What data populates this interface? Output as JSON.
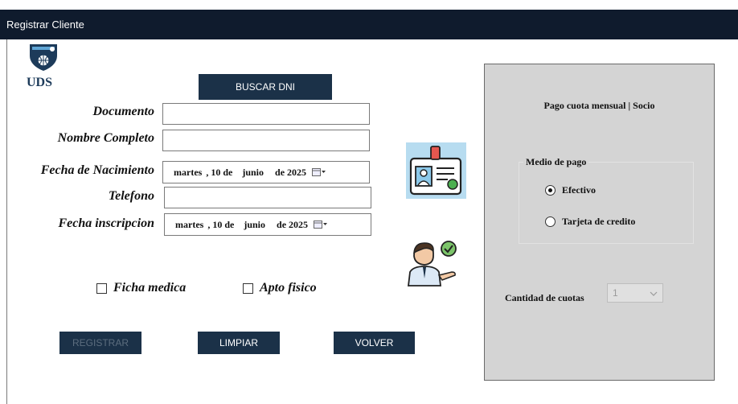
{
  "window": {
    "title": "Registrar Cliente"
  },
  "logo": {
    "text": "UDS"
  },
  "buttons": {
    "buscar_dni": "BUSCAR DNI",
    "registrar": "REGISTRAR",
    "limpiar": "LIMPIAR",
    "volver": "VOLVER"
  },
  "form": {
    "documento_label": "Documento",
    "nombre_label": "Nombre Completo",
    "fecha_nac_label": "Fecha de Nacimiento",
    "telefono_label": "Telefono",
    "fecha_insc_label": "Fecha inscripcion",
    "fecha_nac": {
      "weekday": "martes",
      "day": ", 10 de",
      "month": "junio",
      "year": "de 2025"
    },
    "fecha_insc": {
      "weekday": "martes",
      "day": ", 10 de",
      "month": "junio",
      "year": "de 2025"
    }
  },
  "checks": {
    "ficha_medica": "Ficha medica",
    "apto_fisico": "Apto fisico"
  },
  "panel": {
    "title": "Pago cuota mensual | Socio",
    "group_label": "Medio de pago",
    "radio_efectivo": "Efectivo",
    "radio_tarjeta": "Tarjeta de credito",
    "selected": "Efectivo",
    "cuotas_label": "Cantidad de cuotas",
    "cuotas_value": "1"
  },
  "colors": {
    "titlebar": "#0f1b2d",
    "button": "#1b3148",
    "panel": "#d4d4d4"
  },
  "icons": [
    "uds-logo-icon",
    "id-card-icon",
    "user-check-icon",
    "calendar-icon",
    "chevron-down-icon"
  ]
}
